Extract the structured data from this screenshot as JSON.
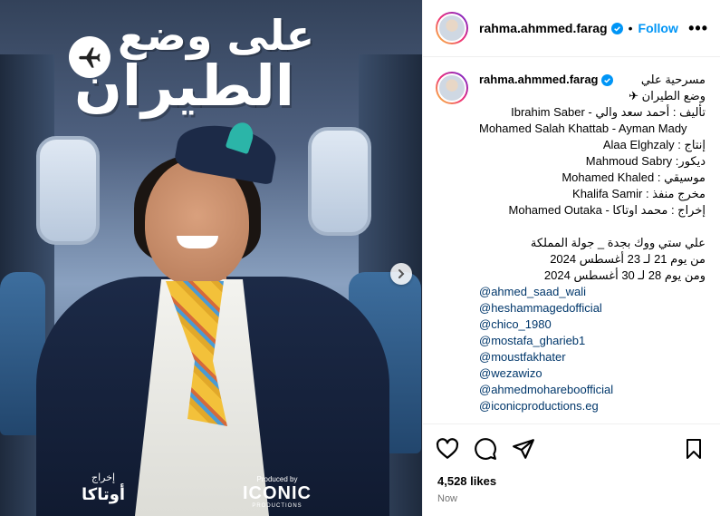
{
  "post": {
    "media": {
      "title_line1": "على وضع",
      "title_line2": "الطيران",
      "director_label": "إخراج",
      "director_name": "أوتاكا",
      "produced_by": "Produced by",
      "producer_brand": "ICONIC",
      "producer_sub": "PRODUCTIONS"
    },
    "header": {
      "username": "rahma.ahmmed.farag",
      "dot": "•",
      "follow_label": "Follow",
      "more_label": "•••"
    },
    "caption": {
      "username": "rahma.ahmmed.farag",
      "line1": "مسرحية علي",
      "line2": "وضع الطيران ✈",
      "line3": "تأليف : أحمد سعد والي - Ibrahim Saber",
      "line4": "Mohamed Salah Khattab - Ayman Mady",
      "line5": "إنتاج : Alaa Elghzaly",
      "line6": "ديكور: Mahmoud Sabry",
      "line7": "موسيقي : Mohamed Khaled",
      "line8": "مخرج منفذ : Khalifa Samir",
      "line9": "إخراج : محمد اوتاكا - Mohamed Outaka",
      "line10": "علي ستي ووك بجدة _ جولة المملكة",
      "line11": "من يوم 21 لـ 23 أغسطس 2024",
      "line12": "ومن يوم 28 لـ 30 أغسطس 2024",
      "mentions": [
        "@ahmed_saad_wali",
        "@heshammagedofficial",
        "@chico_1980",
        "@mostafa_gharieb1",
        "@moustfakhater",
        "@wezawizo",
        "@ahmedmohareboofficial",
        "@iconicproductions.eg"
      ]
    },
    "likes": "4,528 likes",
    "time": "Now",
    "colors": {
      "accent": "#0095f6",
      "mention": "#00376b",
      "muted": "#737373"
    },
    "icons": [
      "heart-icon",
      "comment-icon",
      "share-icon",
      "bookmark-icon",
      "verified-icon",
      "plane-icon",
      "chevron-right-icon"
    ]
  }
}
